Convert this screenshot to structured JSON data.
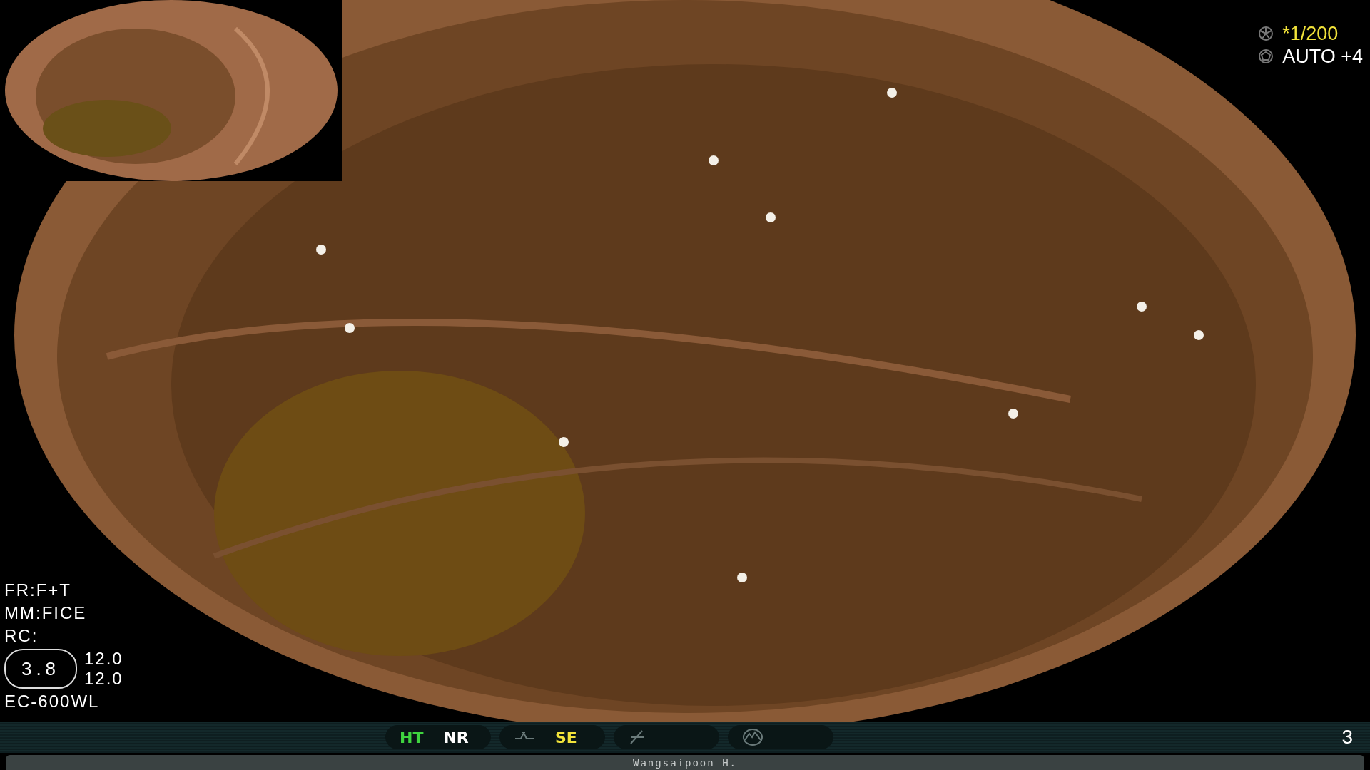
{
  "top_right": [
    {
      "text": "*1/200",
      "color": "#f2e33a",
      "kind": "shutter"
    },
    {
      "text": "AUTO +4",
      "color": "#ffffff",
      "kind": "iris"
    }
  ],
  "bottom_left": {
    "lines": [
      "FR:F+T",
      "MM:FICE",
      "RC:"
    ],
    "oval_value": "3.8",
    "readings": [
      "12.0",
      "12.0"
    ],
    "scope_model": "EC-600WL"
  },
  "status_bar": {
    "groups": [
      {
        "kind": "plain",
        "items": [
          {
            "text": "HT",
            "color": "#3fd43f"
          },
          {
            "text": "NR",
            "color": "#ffffff"
          }
        ]
      },
      {
        "kind": "curve",
        "items": [
          {
            "text": "SE",
            "color": "#f2e33a"
          }
        ]
      },
      {
        "kind": "slash"
      },
      {
        "kind": "wave"
      }
    ],
    "page_number": "3"
  },
  "name_bar": {
    "text": "Wangsaipoon H."
  }
}
